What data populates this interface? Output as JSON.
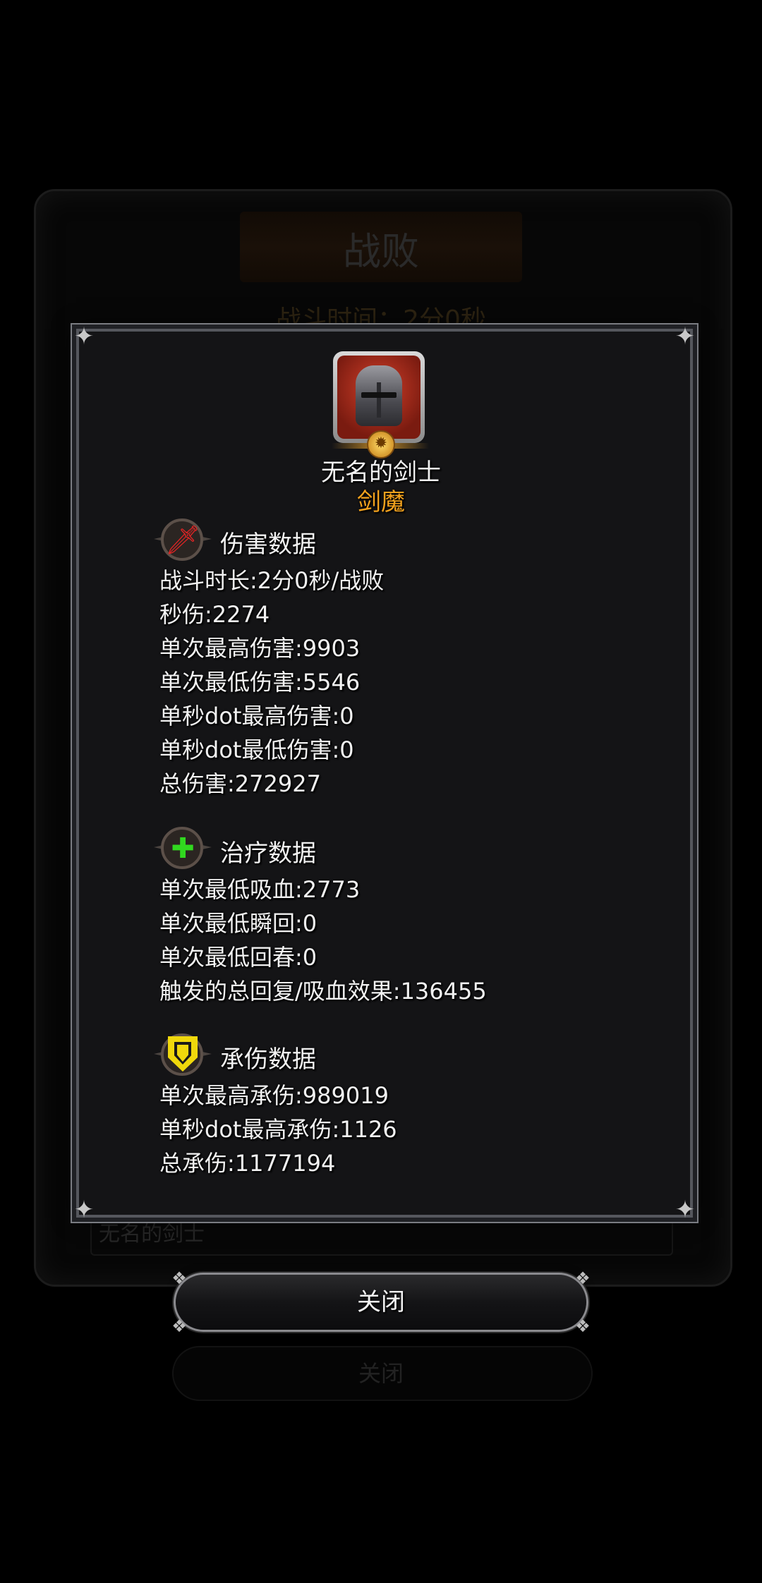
{
  "background_dialog": {
    "title": "战败",
    "battle_time": "战斗时间：2分0秒",
    "name_field": "无名的剑士",
    "button_label": "关闭"
  },
  "hero": {
    "name": "无名的剑士",
    "class": "剑魔",
    "portrait_icon": "armored-knight-portrait"
  },
  "sections": {
    "damage": {
      "title": "伤害数据",
      "icon": "red-sword-icon",
      "lines": [
        "战斗时长:2分0秒/战败",
        "秒伤:2274",
        "单次最高伤害:9903",
        "单次最低伤害:5546",
        "单秒dot最高伤害:0",
        "单秒dot最低伤害:0",
        "总伤害:272927"
      ]
    },
    "healing": {
      "title": "治疗数据",
      "icon": "green-plus-icon",
      "lines": [
        "单次最低吸血:2773",
        "单次最低瞬回:0",
        "单次最低回春:0",
        "触发的总回复/吸血效果:136455"
      ]
    },
    "tanking": {
      "title": "承伤数据",
      "icon": "yellow-shield-icon",
      "lines": [
        "单次最高承伤:989019",
        "单秒dot最高承伤:1126",
        "总承伤:1177194"
      ]
    }
  },
  "close_button": {
    "label": "关闭"
  },
  "colors": {
    "accent_class": "#f3a21d",
    "damage_icon": "#e32424",
    "healing_icon": "#31d81f",
    "tanking_icon": "#f0d80c"
  }
}
